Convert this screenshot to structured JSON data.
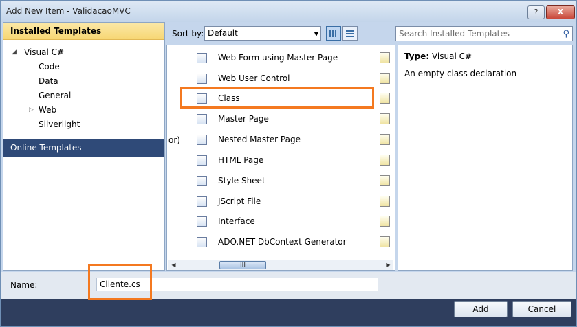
{
  "window": {
    "title": "Add New Item - ValidacaoMVC",
    "help_glyph": "?",
    "close_glyph": "X"
  },
  "left": {
    "installed_header": "Installed Templates",
    "tree": [
      {
        "label": "Visual C#",
        "expanded": true
      },
      {
        "label": "Code"
      },
      {
        "label": "Data"
      },
      {
        "label": "General"
      },
      {
        "label": "Web",
        "collapsed": true
      },
      {
        "label": "Silverlight"
      }
    ],
    "online": "Online Templates"
  },
  "toolbar": {
    "sort_label": "Sort by:",
    "sort_value": "Default"
  },
  "items": [
    {
      "label": "Web Form using Master Page",
      "icon": "web-form-icon"
    },
    {
      "label": "Web User Control",
      "icon": "user-control-icon"
    },
    {
      "label": "Class",
      "icon": "class-icon",
      "selected": true
    },
    {
      "label": "Master Page",
      "icon": "master-page-icon"
    },
    {
      "label": "Nested Master Page",
      "icon": "nested-master-icon"
    },
    {
      "label": "HTML Page",
      "icon": "html-page-icon"
    },
    {
      "label": "Style Sheet",
      "icon": "style-sheet-icon"
    },
    {
      "label": "JScript File",
      "icon": "jscript-icon"
    },
    {
      "label": "Interface",
      "icon": "interface-icon"
    },
    {
      "label": "ADO.NET DbContext Generator",
      "icon": "ado-net-icon"
    }
  ],
  "partial_text": "or)",
  "scrollbar": {
    "thumb_glyph": "III"
  },
  "search": {
    "placeholder": "Search Installed Templates"
  },
  "details": {
    "type_label": "Type:",
    "type_value": "Visual C#",
    "description": "An empty class declaration"
  },
  "name": {
    "label": "Name:",
    "value": "Cliente.cs"
  },
  "buttons": {
    "add": "Add",
    "cancel": "Cancel"
  },
  "colors": {
    "accent_highlight": "#f47920",
    "selection_bg": "#2f4a78",
    "header_gold": "#f7d774"
  }
}
